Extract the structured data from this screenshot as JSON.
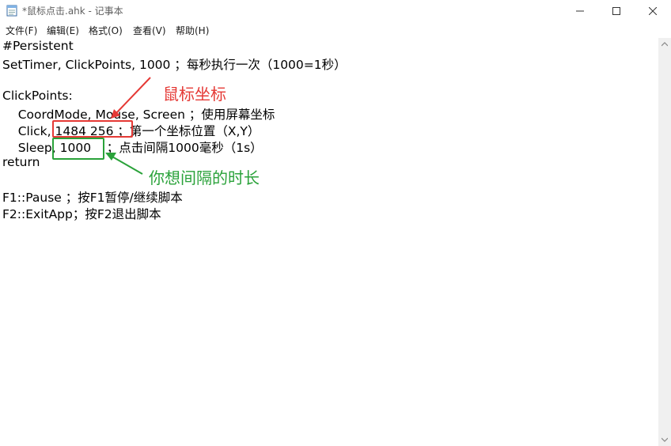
{
  "window": {
    "title": "*鼠标点击.ahk - 记事本"
  },
  "menu": [
    "文件(F)",
    "编辑(E)",
    "格式(O)",
    "查看(V)",
    "帮助(H)"
  ],
  "lines": [
    "#Persistent",
    "SetTimer, ClickPoints, 1000 ；每秒执行一次（1000=1秒）",
    "",
    "ClickPoints:",
    "    CoordMode, Mouse, Screen ；使用屏幕坐标",
    "    Click, 1484 256 ；第一个坐标位置（X,Y）",
    "    Sleep, 1000    ；点击间隔1000毫秒（1s）",
    "return",
    "",
    "F1::Pause ；按F1暂停/继续脚本",
    "F2::ExitApp；按F2退出脚本"
  ],
  "annotations": {
    "coords_label": "鼠标坐标",
    "interval_label": "你想间隔的时长",
    "red": "#e53935",
    "green": "#2aa23a"
  }
}
